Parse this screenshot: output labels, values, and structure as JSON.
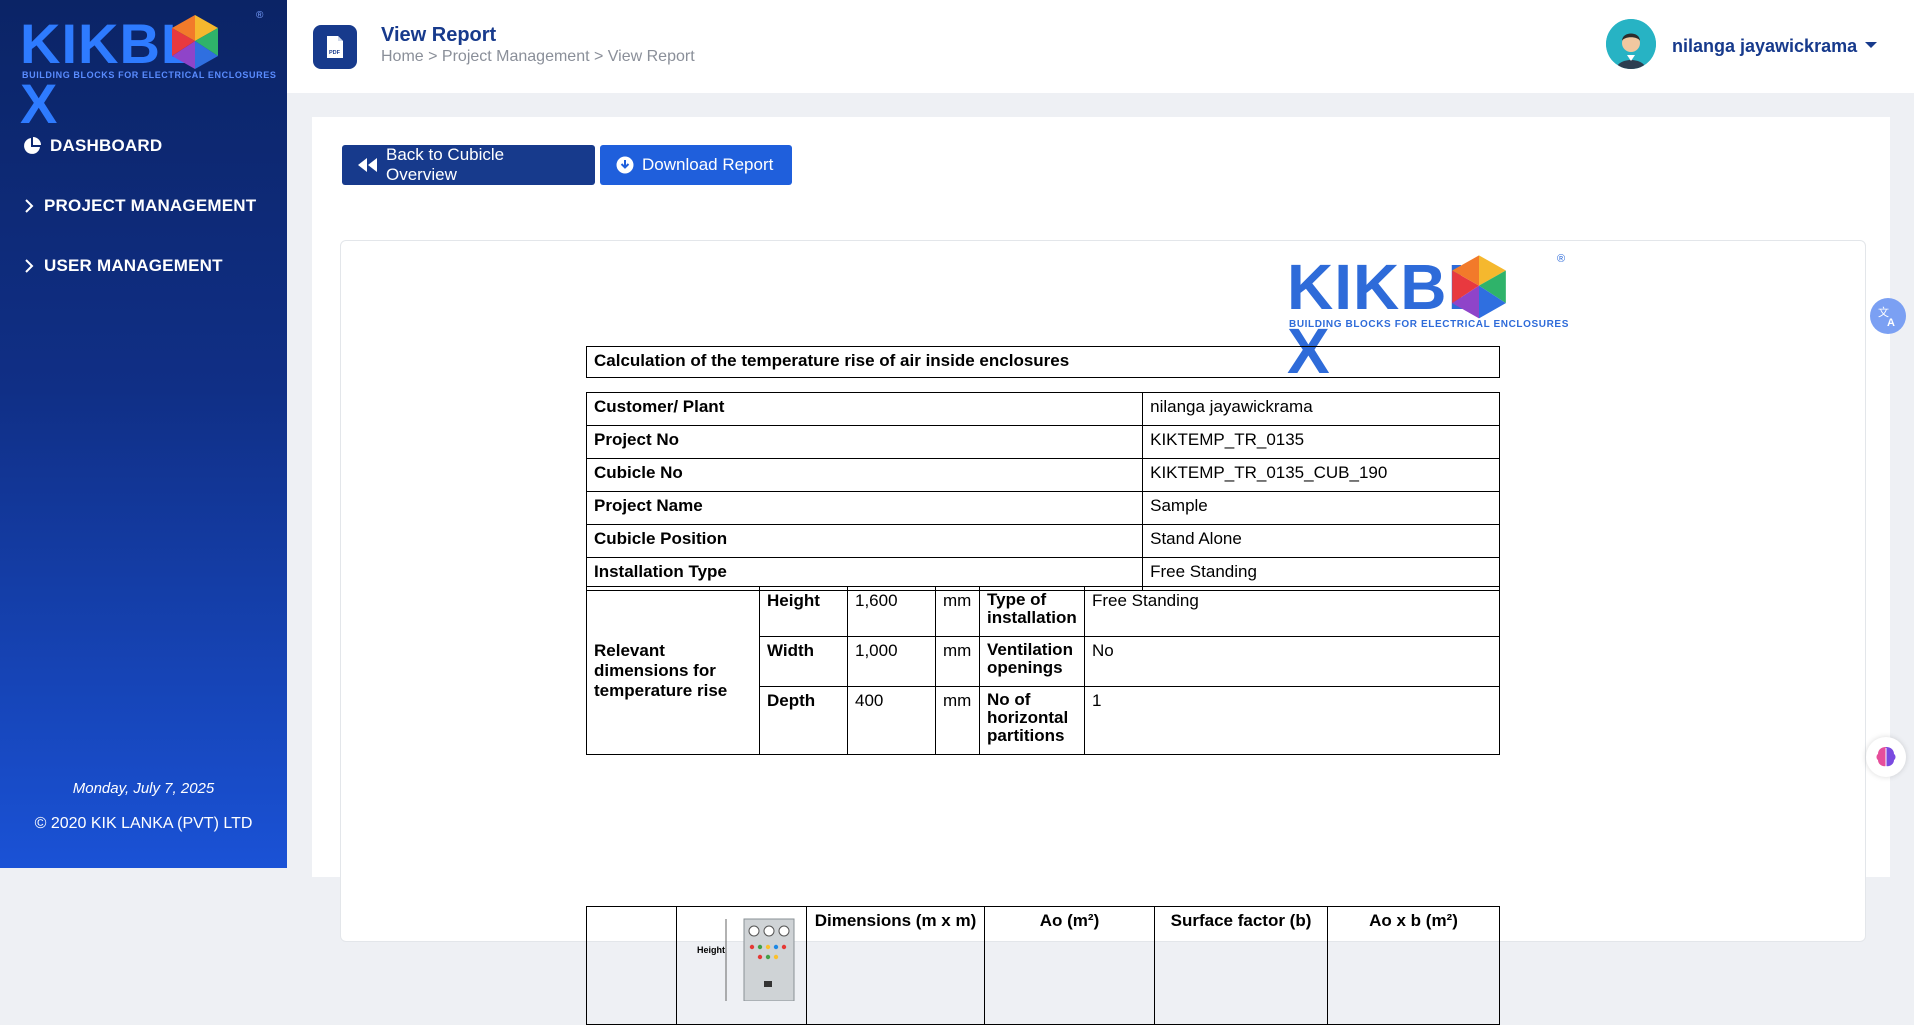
{
  "brand": {
    "logo_text_left": "KIKBL",
    "logo_text_right": "X",
    "logo_tagline": "BUILDING BLOCKS FOR ELECTRICAL ENCLOSURES",
    "registered": "®",
    "colors": {
      "primary": "#173a8c",
      "accent": "#1f5fdc",
      "sidebar_top": "#0b2466",
      "sidebar_bottom": "#1a52d6"
    }
  },
  "sidebar": {
    "items": [
      {
        "label": "DASHBOARD",
        "icon": "pie-chart-icon"
      },
      {
        "label": "PROJECT MANAGEMENT",
        "icon": "chevron-right-icon"
      },
      {
        "label": "USER MANAGEMENT",
        "icon": "chevron-right-icon"
      }
    ],
    "date": "Monday, July 7, 2025",
    "copyright": "© 2020 KIK LANKA (PVT) LTD"
  },
  "header": {
    "title": "View Report",
    "breadcrumb": "Home > Project Management > View Report",
    "user_name": "nilanga jayawickrama"
  },
  "actions": {
    "back_label": "Back to Cubicle Overview",
    "download_label": "Download Report"
  },
  "report": {
    "title": "Calculation of the temperature rise of air inside enclosures",
    "info": [
      {
        "label": "Customer/ Plant",
        "value": "nilanga jayawickrama"
      },
      {
        "label": "Project No",
        "value": "KIKTEMP_TR_0135"
      },
      {
        "label": "Cubicle No",
        "value": "KIKTEMP_TR_0135_CUB_190"
      },
      {
        "label": "Project Name",
        "value": "Sample"
      },
      {
        "label": "Cubicle Position",
        "value": "Stand Alone"
      },
      {
        "label": "Installation Type",
        "value": "Free Standing"
      }
    ],
    "dimensions": {
      "group_label": "Relevant dimensions for temperature rise",
      "rows": [
        {
          "name": "Height",
          "value": "1,600",
          "unit": "mm",
          "prop": "Type of installation",
          "prop_value": "Free Standing"
        },
        {
          "name": "Width",
          "value": "1,000",
          "unit": "mm",
          "prop": "Ventilation openings",
          "prop_value": "No"
        },
        {
          "name": "Depth",
          "value": "400",
          "unit": "mm",
          "prop": "No of horizontal partitions",
          "prop_value": "1"
        }
      ]
    },
    "surface_table": {
      "image_label": "Height",
      "headers": [
        "Dimensions (m x m)",
        "Ao (m²)",
        "Surface factor (b)",
        "Ao x b (m²)"
      ]
    }
  }
}
